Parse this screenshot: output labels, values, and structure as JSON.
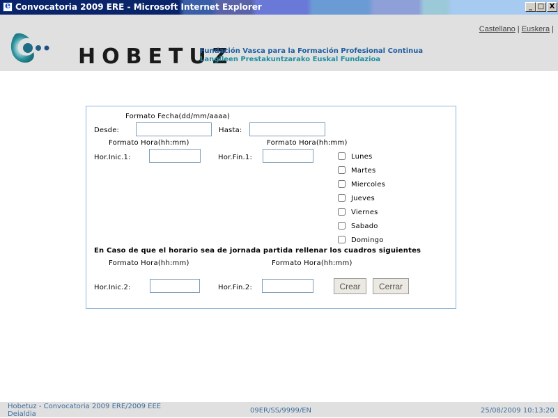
{
  "window": {
    "title": "Convocatoria 2009 ERE - Microsoft Internet Explorer",
    "minimize": "_",
    "maximize": "□",
    "close": "X"
  },
  "header": {
    "lang_castellano": "Castellano",
    "lang_sep": " | ",
    "lang_euskera": "Euskera",
    "lang_end": " |",
    "logo_word": "HOBETUZ",
    "logo_es": "Fundación Vasca para la Formación Profesional Continua",
    "logo_eu": "Langileen Prestakuntzarako Euskal Fundazioa",
    "colors": {
      "brand_blue": "#1e5fa0",
      "brand_teal": "#1e8fa0",
      "swirl": "#2a8f9a"
    }
  },
  "form": {
    "date_format": "Formato Fecha(dd/mm/aaaa)",
    "desde_label": "Desde:",
    "desde_value": "",
    "hasta_label": "Hasta:",
    "hasta_value": "",
    "hour_format_1": "Formato Hora(hh:mm)",
    "hour_format_2": "Formato Hora(hh:mm)",
    "hor_inic1_label": "Hor.Inic.1:",
    "hor_inic1_value": "",
    "hor_fin1_label": "Hor.Fin.1:",
    "hor_fin1_value": "",
    "days": [
      {
        "label": "Lunes",
        "checked": false
      },
      {
        "label": "Martes",
        "checked": false
      },
      {
        "label": "Miercoles",
        "checked": false
      },
      {
        "label": "Jueves",
        "checked": false
      },
      {
        "label": "Viernes",
        "checked": false
      },
      {
        "label": "Sabado",
        "checked": false
      },
      {
        "label": "Domingo",
        "checked": false
      }
    ],
    "split_notice": "En Caso de que el horario sea de jornada partida rellenar los cuadros siguientes",
    "hour_format_3": "Formato Hora(hh:mm)",
    "hour_format_4": "Formato Hora(hh:mm)",
    "hor_inic2_label": "Hor.Inic.2:",
    "hor_inic2_value": "",
    "hor_fin2_label": "Hor.Fin.2:",
    "hor_fin2_value": "",
    "crear_button": "Crear",
    "cerrar_button": "Cerrar"
  },
  "status": {
    "left_line1": "Hobetuz - Convocatoria 2009 ERE/2009 EEE",
    "left_line2": "Deialdia",
    "center": "09ER/SS/9999/EN",
    "right": "25/08/2009 10:13:20"
  }
}
